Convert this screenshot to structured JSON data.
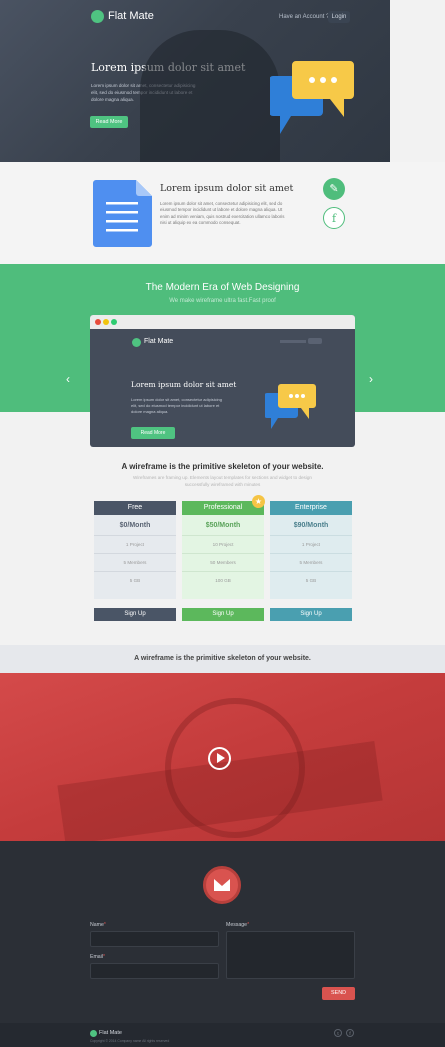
{
  "header": {
    "brand": "Flat Mate",
    "nav_link": "Have an Account ?",
    "login": "Login"
  },
  "hero": {
    "title": "Lorem ipsum dolor sit amet",
    "text_lines": [
      "Lorem ipsum dolor sit amet, consectetur adipisicing",
      "elit, sed do eiusmod tempor incididunt ut labore et",
      "dolore magna aliqua."
    ],
    "button": "Read More"
  },
  "feature": {
    "title": "Lorem ipsum dolor sit amet",
    "text_lines": [
      "Lorem ipsum dolor sit amet, consectetur adipisicing elit, sed do",
      "eiusmod tempor incididunt ut labore et dolore magna aliqua. Ut",
      "enim ad minim veniam, quis nostrud exercitation ullamco laboris",
      "nisi ut aliquip ex ea commodo consequat."
    ]
  },
  "slider": {
    "title": "The Modern Era of Web Designing",
    "subtitle": "We make wireframe ultra fast.Fast proof",
    "prev": "‹",
    "next": "›",
    "screen": {
      "brand": "Flat Mate",
      "title": "Lorem ipsum dolor sit amet",
      "text_lines": [
        "Lorem ipsum dolor sit amet, consectetur adipisicing",
        "elit, sed do eiusmod tempor incididunt ut labore et",
        "dolore magna aliqua."
      ],
      "button": "Read More"
    }
  },
  "pricing": {
    "heading": "A wireframe is the primitive skeleton of your website.",
    "sub_lines": [
      "Wireframes are framing up. Elements layout templates for sections and widget to design",
      "successfully wireframed with minutes"
    ],
    "plans": [
      {
        "name": "Free",
        "price": "$0/Month",
        "features": [
          "1 Project",
          "5 Members",
          "5 GB"
        ],
        "signup": "Sign Up",
        "head_color": "#4a5566",
        "body_color": "#e6eaee",
        "price_color": "#5a6473",
        "btn_color": "#4a5566"
      },
      {
        "name": "Professional",
        "price": "$50/Month",
        "features": [
          "10 Project",
          "50 Members",
          "100 GB"
        ],
        "signup": "Sign Up",
        "head_color": "#5cb85c",
        "body_color": "#e3f5e3",
        "price_color": "#5aa35a",
        "btn_color": "#5cb85c"
      },
      {
        "name": "Enterprise",
        "price": "$90/Month",
        "features": [
          "1 Project",
          "5 Members",
          "5 GB"
        ],
        "signup": "Sign Up",
        "head_color": "#4a9fb0",
        "body_color": "#dfecef",
        "price_color": "#4a7f8c",
        "btn_color": "#4a9fb0"
      }
    ]
  },
  "strip": {
    "text": "A wireframe is the primitive skeleton of your website."
  },
  "contact": {
    "name_label": "Name",
    "email_label": "Email",
    "message_label": "Message",
    "send": "SEND"
  },
  "footer": {
    "brand": "Flat Mate",
    "copyright": "Copyright © 2014 Company name All rights reserved"
  }
}
